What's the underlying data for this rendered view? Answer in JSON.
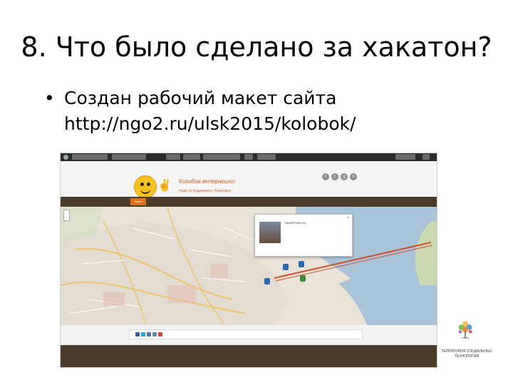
{
  "slide": {
    "title": "8. Что было сделано за хакатон?",
    "bullet": "•",
    "bullet_text": "Создан рабочий макет сайта",
    "bullet_url": "http://ngo2.ru/ulsk2015/kolobok/"
  },
  "site": {
    "name": "Колобок-интернешнл",
    "subtitle": "Надо то поддержать Ульяновск",
    "nav_button": "Карта",
    "social": [
      "f",
      "t",
      "g",
      "v"
    ]
  },
  "map": {
    "popup_title": "ПАМЯТНИК НА ..."
  },
  "logo": {
    "text_line1": "ТЕРРИТОРИЯ СОЦИАЛЬНЫХ",
    "text_line2": "ТЕХНОЛОГИЙ"
  },
  "colors": {
    "header_brown": "#4a3b2a",
    "accent_orange": "#e0701a",
    "marker_blue": "#2a6ab5"
  }
}
